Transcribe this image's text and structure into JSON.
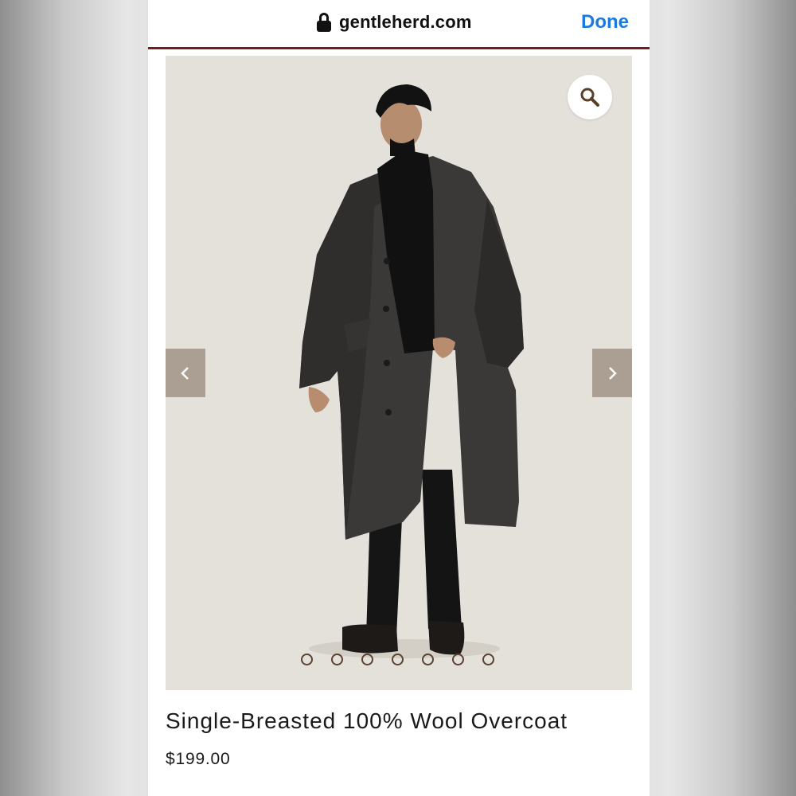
{
  "browser": {
    "url": "gentleherd.com",
    "done_label": "Done"
  },
  "product": {
    "title": "Single-Breasted 100% Wool Overcoat",
    "price": "$199.00"
  },
  "gallery": {
    "image_count": 7,
    "active_index": 0
  },
  "colors": {
    "accent_link": "#1a7ae0",
    "divider": "#7a1c1c",
    "arrow_bg": "#ab9e92",
    "image_bg": "#e4e0da"
  }
}
